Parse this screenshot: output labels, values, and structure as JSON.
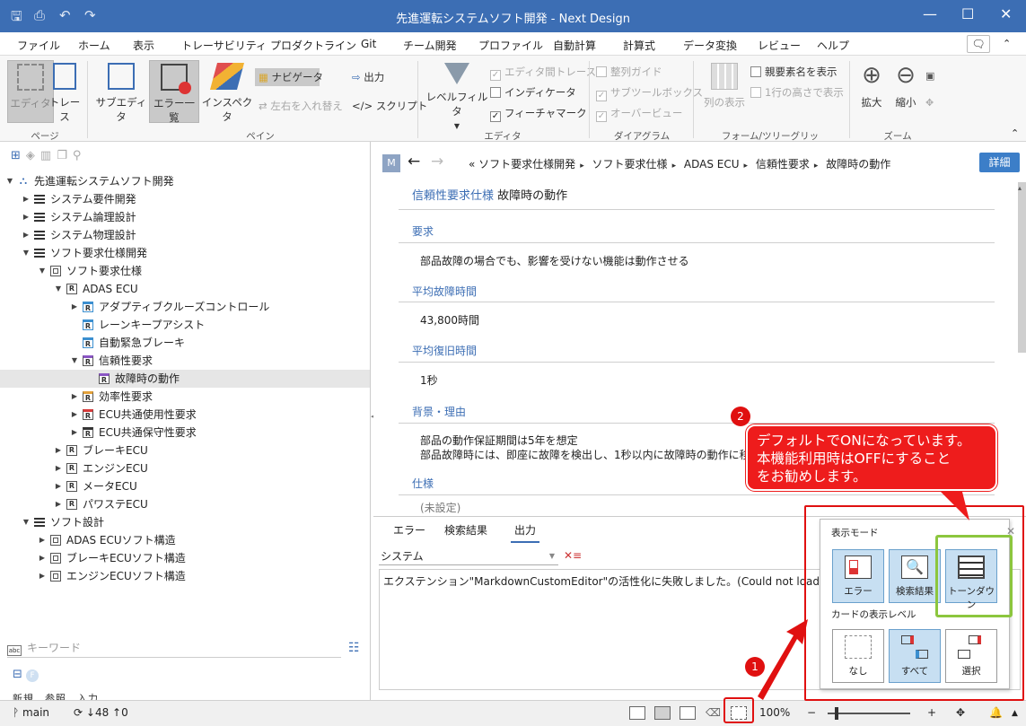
{
  "window": {
    "title": "先進運転システムソフト開発 - Next Design",
    "quick_access": [
      "save-icon",
      "save-all-icon",
      "undo-icon",
      "redo-icon"
    ],
    "controls": {
      "minimize": "—",
      "maximize": "☐",
      "close": "✕"
    }
  },
  "menu": {
    "tabs": [
      "ファイル",
      "ホーム",
      "表示",
      "トレーサビリティ",
      "プロダクトライン",
      "Git",
      "チーム開発",
      "プロファイル",
      "自動計算",
      "計算式",
      "データ変換",
      "レビュー",
      "ヘルプ"
    ],
    "active": "表示"
  },
  "ribbon": {
    "page": {
      "editor": "エディタ",
      "trace": "トレース",
      "group": "ページ"
    },
    "pane": {
      "sub_editor": "サブエディタ",
      "error_list": "エラー一覧",
      "inspector": "インスペクタ",
      "navigator": "ナビゲータ",
      "swap": "左右を入れ替え",
      "output": "出力",
      "script": "スクリプト",
      "group": "ペイン"
    },
    "editor": {
      "level_filter": "レベルフィルタ",
      "inter_editor_trace": "エディタ間トレース",
      "indicator": "インディケータ",
      "feature_mark": "フィーチャマーク",
      "group": "エディタ"
    },
    "diagram": {
      "align_guide": "整列ガイド",
      "sub_toolbox": "サブツールボックス",
      "overview": "オーバービュー",
      "group": "ダイアグラム"
    },
    "form": {
      "column_display": "列の表示",
      "show_parent_name": "親要素名を表示",
      "one_line_height": "1行の高さで表示",
      "group": "フォーム/ツリーグリッド"
    },
    "zoom": {
      "zoom_in": "拡大",
      "zoom_out": "縮小",
      "group": "ズーム"
    }
  },
  "tree": {
    "items": [
      {
        "label": "先進運転システムソフト開発",
        "depth": 0,
        "expanded": true,
        "icon": "project"
      },
      {
        "label": "システム要件開発",
        "depth": 1,
        "expanded": false,
        "icon": "list"
      },
      {
        "label": "システム論理設計",
        "depth": 1,
        "expanded": false,
        "icon": "list"
      },
      {
        "label": "システム物理設計",
        "depth": 1,
        "expanded": false,
        "icon": "list"
      },
      {
        "label": "ソフト要求仕様開発",
        "depth": 1,
        "expanded": true,
        "icon": "list"
      },
      {
        "label": "ソフト要求仕様",
        "depth": 2,
        "expanded": true,
        "icon": "struct"
      },
      {
        "label": "ADAS ECU",
        "depth": 3,
        "expanded": true,
        "icon": "req"
      },
      {
        "label": "アダプティブクルーズコントロール",
        "depth": 4,
        "expanded": false,
        "icon": "req-b"
      },
      {
        "label": "レーンキープアシスト",
        "depth": 4,
        "expanded": null,
        "icon": "req-b"
      },
      {
        "label": "自動緊急ブレーキ",
        "depth": 4,
        "expanded": null,
        "icon": "req-b"
      },
      {
        "label": "信頼性要求",
        "depth": 4,
        "expanded": true,
        "icon": "req-p"
      },
      {
        "label": "故障時の動作",
        "depth": 5,
        "expanded": null,
        "icon": "req-p",
        "selected": true
      },
      {
        "label": "効率性要求",
        "depth": 4,
        "expanded": false,
        "icon": "req-o"
      },
      {
        "label": "ECU共通使用性要求",
        "depth": 4,
        "expanded": false,
        "icon": "req-r"
      },
      {
        "label": "ECU共通保守性要求",
        "depth": 4,
        "expanded": false,
        "icon": "req-k"
      },
      {
        "label": "ブレーキECU",
        "depth": 3,
        "expanded": false,
        "icon": "req"
      },
      {
        "label": "エンジンECU",
        "depth": 3,
        "expanded": false,
        "icon": "req"
      },
      {
        "label": "メータECU",
        "depth": 3,
        "expanded": false,
        "icon": "req"
      },
      {
        "label": "パワステECU",
        "depth": 3,
        "expanded": false,
        "icon": "req"
      },
      {
        "label": "ソフト設計",
        "depth": 1,
        "expanded": true,
        "icon": "list"
      },
      {
        "label": "ADAS ECUソフト構造",
        "depth": 2,
        "expanded": false,
        "icon": "struct"
      },
      {
        "label": "ブレーキECUソフト構造",
        "depth": 2,
        "expanded": false,
        "icon": "struct"
      },
      {
        "label": "エンジンECUソフト構造",
        "depth": 2,
        "expanded": false,
        "icon": "struct"
      }
    ],
    "keyword_placeholder": "キーワード",
    "bottom_tabs": "新規　参照　入力"
  },
  "editor": {
    "badge": "M",
    "breadcrumb": [
      "«",
      "ソフト要求仕様開発",
      "ソフト要求仕様",
      "ADAS ECU",
      "信頼性要求",
      "故障時の動作"
    ],
    "detail_button": "詳細",
    "form_class": "信頼性要求仕様",
    "form_name": "故障時の動作",
    "fields": [
      {
        "label": "要求",
        "value": "部品故障の場合でも、影響を受けない機能は動作させる"
      },
      {
        "label": "平均故障時間",
        "value": "43,800時間"
      },
      {
        "label": "平均復旧時間",
        "value": "1秒"
      },
      {
        "label": "背景・理由",
        "value": "部品の動作保証期間は5年を想定",
        "value2": "部品故障時には、即座に故障を検出し、1秒以内に故障時の動作に移行す"
      },
      {
        "label": "仕様",
        "value": "(未設定)"
      }
    ]
  },
  "output": {
    "tabs": [
      "エラー",
      "検索結果",
      "出力"
    ],
    "active_tab": "出力",
    "source": "システム",
    "message": "エクステンション\"MarkdownCustomEditor\"の活性化に失敗しました。(Could not load file or ass"
  },
  "popup": {
    "display_mode_title": "表示モード",
    "modes": [
      "エラー",
      "検索結果",
      "トーンダウン"
    ],
    "card_level_title": "カードの表示レベル",
    "levels": [
      "なし",
      "すべて",
      "選択"
    ]
  },
  "callout": {
    "line1": "デフォルトでONになっています。",
    "line2": "本機能利用時はOFFにすること",
    "line3": "をお勧めします。"
  },
  "markers": {
    "one": "1",
    "two": "2"
  },
  "status": {
    "branch": "main",
    "sync": "↓48 ↑0",
    "zoom": "100%"
  },
  "colors": {
    "title_bar": "#3c6eb4",
    "annotation_red": "#e01010",
    "highlight_green": "#8cc63e"
  }
}
